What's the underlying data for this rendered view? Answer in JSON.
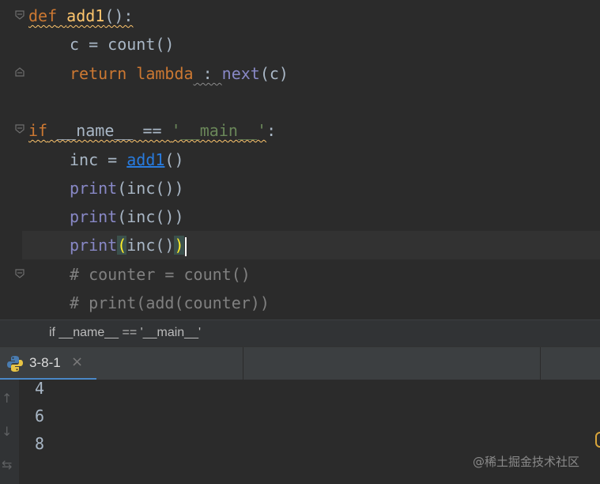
{
  "editor": {
    "lines": {
      "l1": {
        "def": "def",
        "name": "add1",
        "rest": "():"
      },
      "l2": {
        "text": "c = count()"
      },
      "l3": {
        "ret": "return",
        "lam": "lambda",
        "colon": " : ",
        "next": "next",
        "args": "(c)"
      },
      "l4": {
        "if": "if",
        "rest1": " __name__ == ",
        "str": "'__main__'",
        "rest2": ":"
      },
      "l5": {
        "pre": "inc = ",
        "call": "add1",
        "post": "()"
      },
      "l6": {
        "fn": "print",
        "arg": "(inc())"
      },
      "l7": {
        "fn": "print",
        "arg": "(inc())"
      },
      "l8": {
        "fn": "print",
        "open": "(",
        "mid": "inc()",
        "close": ")"
      },
      "l9": {
        "text": "# counter = count()"
      },
      "l10": {
        "text": "# print(add(counter))"
      }
    }
  },
  "breadcrumb": {
    "text": "if __name__ == '__main__'"
  },
  "run": {
    "tab_label": "3-8-1",
    "close_glyph": "×",
    "output": [
      "4",
      "6",
      "8"
    ]
  },
  "watermark": "@稀土掘金技术社区",
  "colors": {
    "keyword": "#cc7832",
    "function": "#ffc66d",
    "builtin": "#8888c6",
    "string": "#6a8759",
    "comment": "#808080",
    "link": "#287bde",
    "tab_accent": "#4a88c7"
  }
}
